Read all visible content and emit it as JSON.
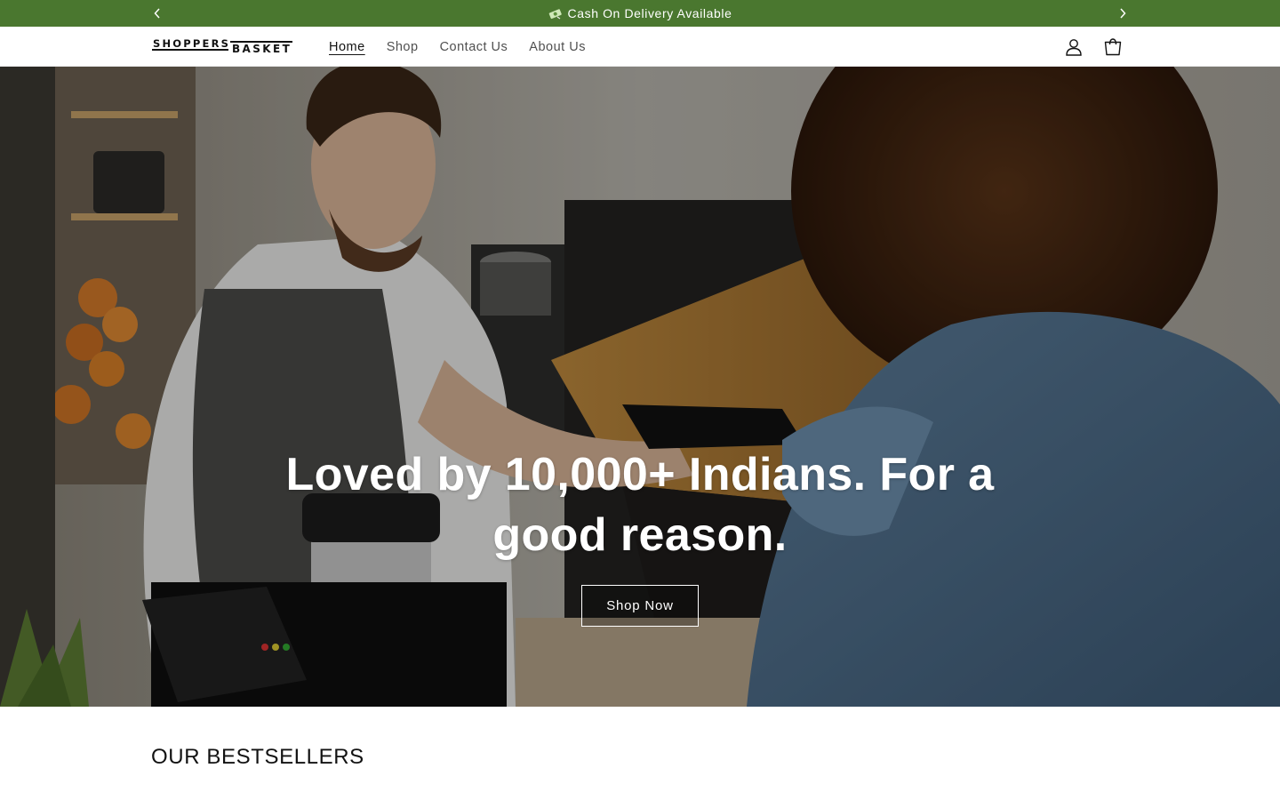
{
  "announcement": {
    "icon": "money-icon",
    "text": "Cash On Delivery Available",
    "background": "#4a772f",
    "prev_icon": "chevron-left-icon",
    "next_icon": "chevron-right-icon"
  },
  "header": {
    "logo": {
      "line1": "SHOPPERS",
      "line2": "BASKET"
    },
    "nav": [
      {
        "label": "Home",
        "active": true
      },
      {
        "label": "Shop",
        "active": false
      },
      {
        "label": "Contact Us",
        "active": false
      },
      {
        "label": "About Us",
        "active": false
      }
    ],
    "icons": {
      "account": "account-icon",
      "cart": "cart-icon"
    }
  },
  "hero": {
    "heading": "Loved by 10,000+ Indians. For a good reason.",
    "button_label": "Shop Now"
  },
  "bestsellers": {
    "title": "OUR BESTSELLERS"
  }
}
